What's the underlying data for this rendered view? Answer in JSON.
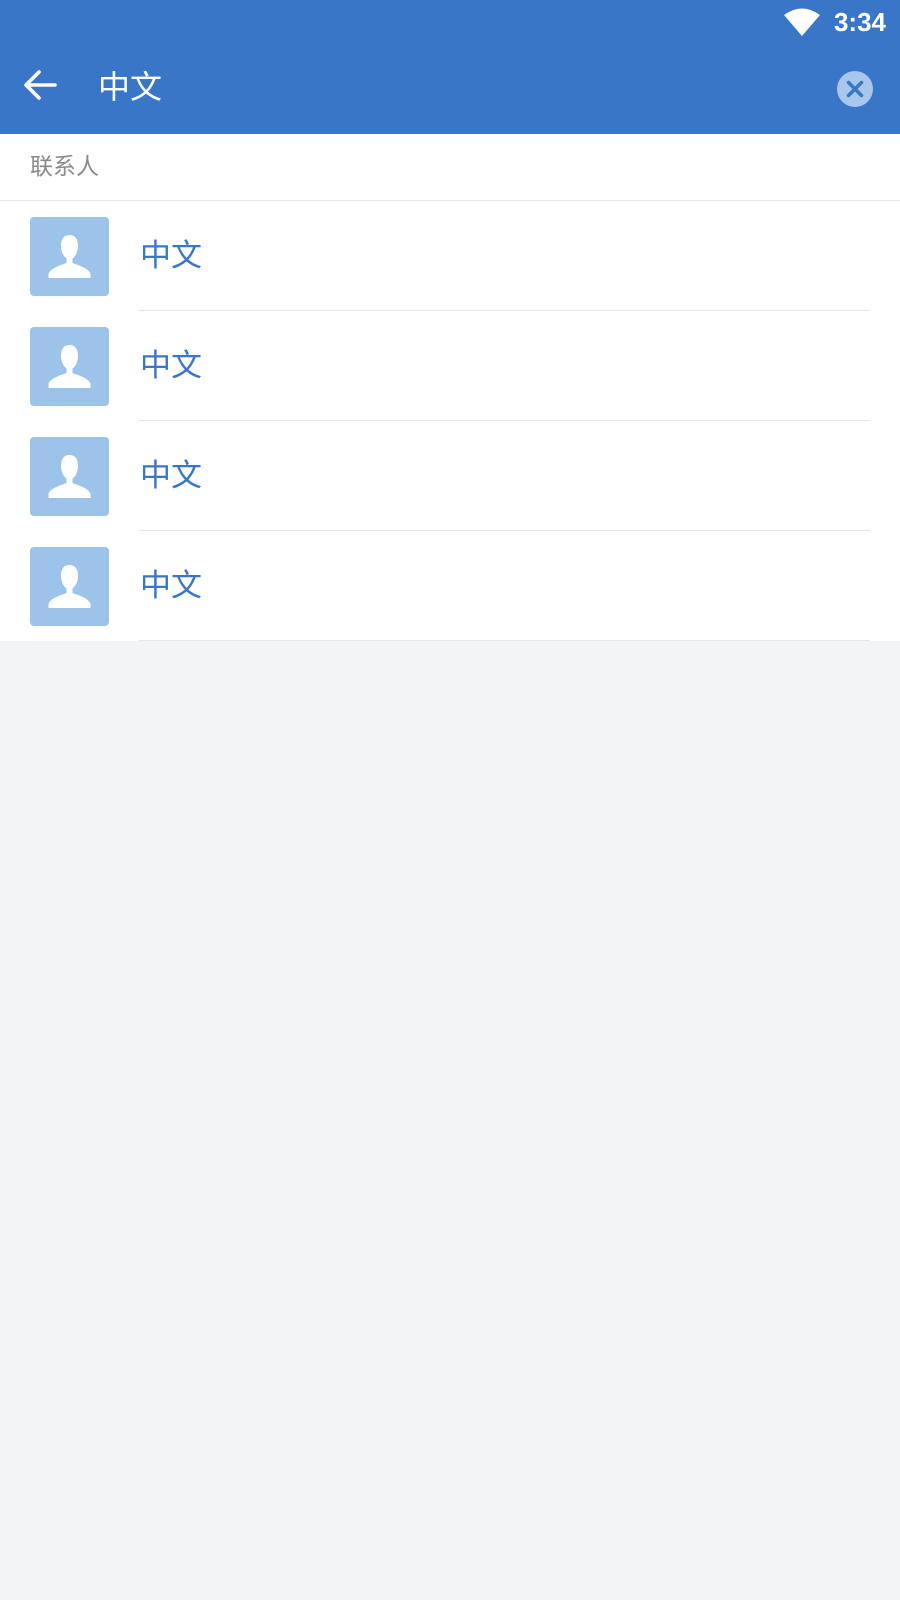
{
  "status_bar": {
    "time": "3:34",
    "icons": [
      "wifi-icon"
    ]
  },
  "app_bar": {
    "back_icon": "arrow-left-icon",
    "search_value": "中文",
    "clear_icon": "close-circle-icon"
  },
  "results": {
    "section_title": "联系人",
    "contacts": [
      {
        "name": "中文",
        "avatar": "person-icon"
      },
      {
        "name": "中文",
        "avatar": "person-icon"
      },
      {
        "name": "中文",
        "avatar": "person-icon"
      },
      {
        "name": "中文",
        "avatar": "person-icon"
      }
    ]
  },
  "colors": {
    "primary": "#3a76c8",
    "avatar_bg": "#9cc3ea",
    "background": "#f3f4f6",
    "section_text": "#8a8a8a"
  }
}
